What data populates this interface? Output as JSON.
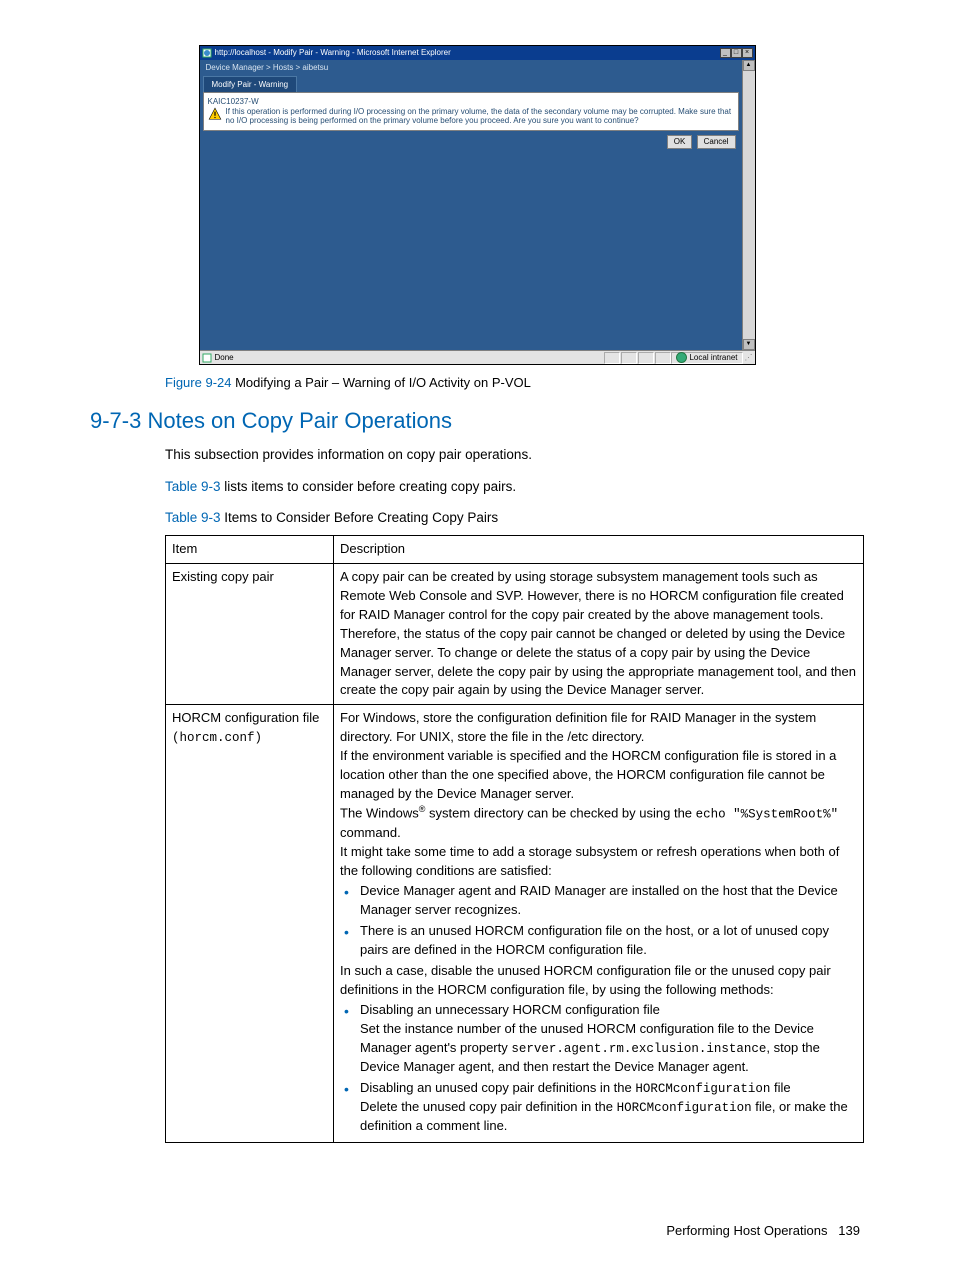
{
  "ie": {
    "title": "http://localhost - Modify Pair - Warning - Microsoft Internet Explorer",
    "breadcrumb": "Device Manager > Hosts > aibetsu",
    "tab": "Modify Pair - Warning",
    "msg_code": "KAIC10237-W",
    "msg_text": "If this operation is performed during I/O processing on the primary volume, the data of the secondary volume may be corrupted. Make sure that no I/O processing is being performed on the primary volume before you proceed. Are you sure you want to continue?",
    "ok": "OK",
    "cancel": "Cancel",
    "status_done": "Done",
    "status_zone": "Local intranet"
  },
  "figure": {
    "num": "Figure 9-24",
    "caption": " Modifying a Pair – Warning of I/O Activity on P-VOL"
  },
  "section": {
    "num": "9-7-3",
    "title": " Notes on Copy Pair Operations"
  },
  "p1": "This subsection provides information on copy pair operations.",
  "p2a": "Table 9-3",
  "p2b": " lists items to consider before creating copy pairs.",
  "tablecap": {
    "num": "Table 9-3",
    "text": "  Items to Consider Before Creating Copy Pairs"
  },
  "th_item": "Item",
  "th_desc": "Description",
  "row1": {
    "item": "Existing copy pair",
    "desc": "A copy pair can be created by using storage subsystem management tools such as Remote Web Console and SVP. However, there is no HORCM configuration file created for RAID Manager control for the copy pair created by the above management tools. Therefore, the status of the copy pair cannot be changed or deleted by using the Device Manager server. To change or delete the status of a copy pair by using the Device Manager server, delete the copy pair by using the appropriate management tool, and then create the copy pair again by using the Device Manager server."
  },
  "row2": {
    "item_line1": "HORCM configuration file",
    "item_line2": "(horcm.conf)",
    "d1": "For Windows, store the configuration definition file for RAID Manager in the system directory. For UNIX, store the file in the /etc directory.",
    "d2": "If the environment variable is specified and the HORCM configuration file is stored in a location other than the one specified above, the HORCM configuration file cannot be managed by the Device Manager server.",
    "d3a": "The Windows",
    "d3b": " system directory can be checked by using the ",
    "d3c": "echo \"%SystemRoot%\"",
    "d3d": " command.",
    "d4": "It might take some time to add a storage subsystem or refresh operations when both of the following conditions are satisfied:",
    "b1": "Device Manager agent and RAID Manager are installed on the host that the Device Manager server recognizes.",
    "b2": "There is an unused HORCM configuration file on the host, or a lot of unused copy pairs are defined in the HORCM configuration file.",
    "d5": "In such a case, disable the unused HORCM configuration file or the unused copy pair definitions in the HORCM configuration file, by using the following methods:",
    "b3": "Disabling an unnecessary HORCM configuration file",
    "b3sub_a": "Set the instance number of the unused HORCM configuration file to the Device Manager agent's property ",
    "b3sub_code": "server.agent.rm.exclusion.instance",
    "b3sub_b": ", stop the Device Manager agent, and then restart the Device Manager agent.",
    "b4a": "Disabling an unused copy pair definitions in the ",
    "b4code": "HORCMconfiguration",
    "b4b": " file",
    "b4sub_a": "Delete the unused copy pair definition in the ",
    "b4sub_code": "HORCMconfiguration",
    "b4sub_b": " file, or make the definition a comment line."
  },
  "footer": {
    "text": "Performing Host Operations",
    "page": "139"
  }
}
